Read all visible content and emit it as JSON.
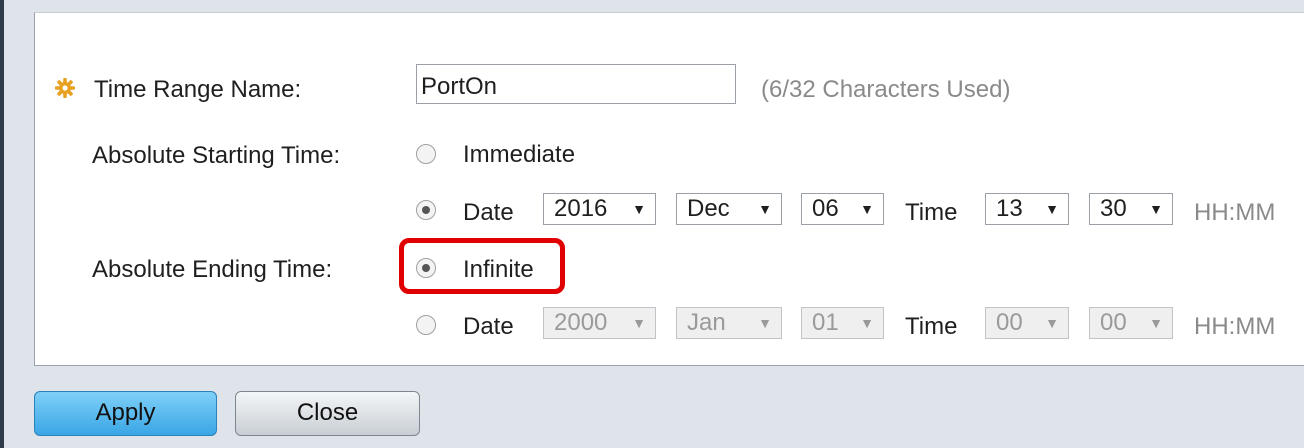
{
  "form": {
    "name_label": "Time Range Name:",
    "name_value": "PortOn",
    "name_hint": "(6/32 Characters Used)",
    "start_label": "Absolute Starting Time:",
    "end_label": "Absolute Ending Time:"
  },
  "start": {
    "immediate_label": "Immediate",
    "immediate_checked": false,
    "date_label": "Date",
    "date_checked": true,
    "year": "2016",
    "month": "Dec",
    "day": "06",
    "time_label": "Time",
    "hour": "13",
    "minute": "30",
    "format": "HH:MM"
  },
  "end": {
    "infinite_label": "Infinite",
    "infinite_checked": true,
    "date_label": "Date",
    "date_checked": false,
    "year": "2000",
    "month": "Jan",
    "day": "01",
    "time_label": "Time",
    "hour": "00",
    "minute": "00",
    "format": "HH:MM"
  },
  "buttons": {
    "apply": "Apply",
    "close": "Close"
  },
  "colors": {
    "highlight": "#e00000",
    "apply_button": "#3aa6e6",
    "required_icon": "#e8a020"
  },
  "arrow_glyph": "▼"
}
